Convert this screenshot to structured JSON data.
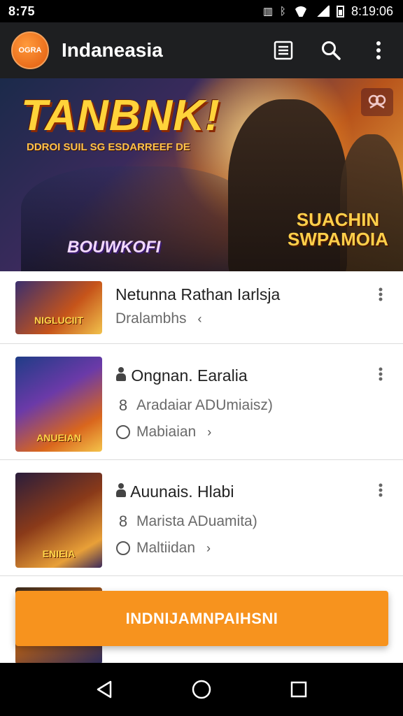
{
  "status_bar": {
    "time_left": "8:75",
    "time_right": "8:19:06",
    "icons": [
      "notification-icon",
      "bluetooth-icon",
      "wifi-icon",
      "signal-icon",
      "battery-icon"
    ]
  },
  "app_bar": {
    "logo_text": "OGRA",
    "title": "Indaneasia",
    "actions": [
      "list-icon",
      "search-icon",
      "more-vert-icon"
    ]
  },
  "hero": {
    "title": "TANBNK!",
    "subtitle": "DDROI SUIL SG ESDARREEF DE",
    "badge_left": "BOUWKOFI",
    "badge_right": "SUACHIN SWPAMOIA"
  },
  "items": [
    {
      "title": "Netunna Rathan Iarlsja",
      "meta": "Dralambhs",
      "thumb_text": "NIGLUCIIT"
    },
    {
      "title": "Ongnan. Earalia",
      "author": "Aradaiar ADUmiaisz)",
      "status": "Mabiaian",
      "thumb_text": "ANUEIAN"
    },
    {
      "title": "Auunais. Hlabi",
      "author": "Marista ADuamita)",
      "status": "Maltiidan",
      "thumb_text": "ENIEIA"
    }
  ],
  "cta": {
    "label": "INDNIJAMNPAIHSNI"
  },
  "colors": {
    "accent": "#f7931e",
    "app_bar": "#1e1f21",
    "status_bar": "#000000"
  }
}
